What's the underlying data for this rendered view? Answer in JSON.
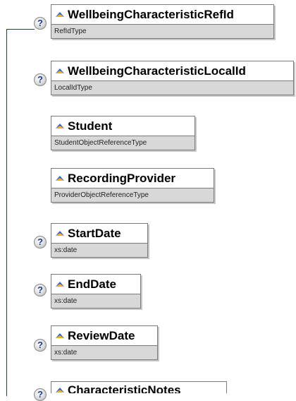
{
  "elements": [
    {
      "name": "WellbeingCharacteristicRefId",
      "type": "RefIdType",
      "optional": true
    },
    {
      "name": "WellbeingCharacteristicLocalId",
      "type": "LocalIdType",
      "optional": true
    },
    {
      "name": "Student",
      "type": "StudentObjectReferenceType",
      "optional": false
    },
    {
      "name": "RecordingProvider",
      "type": "ProviderObjectReferenceType",
      "optional": false
    },
    {
      "name": "StartDate",
      "type": "xs:date",
      "optional": true
    },
    {
      "name": "EndDate",
      "type": "xs:date",
      "optional": true
    },
    {
      "name": "ReviewDate",
      "type": "xs:date",
      "optional": true
    },
    {
      "name": "CharacteristicNotes",
      "type": "",
      "optional": true
    }
  ],
  "optional_marker": "?"
}
